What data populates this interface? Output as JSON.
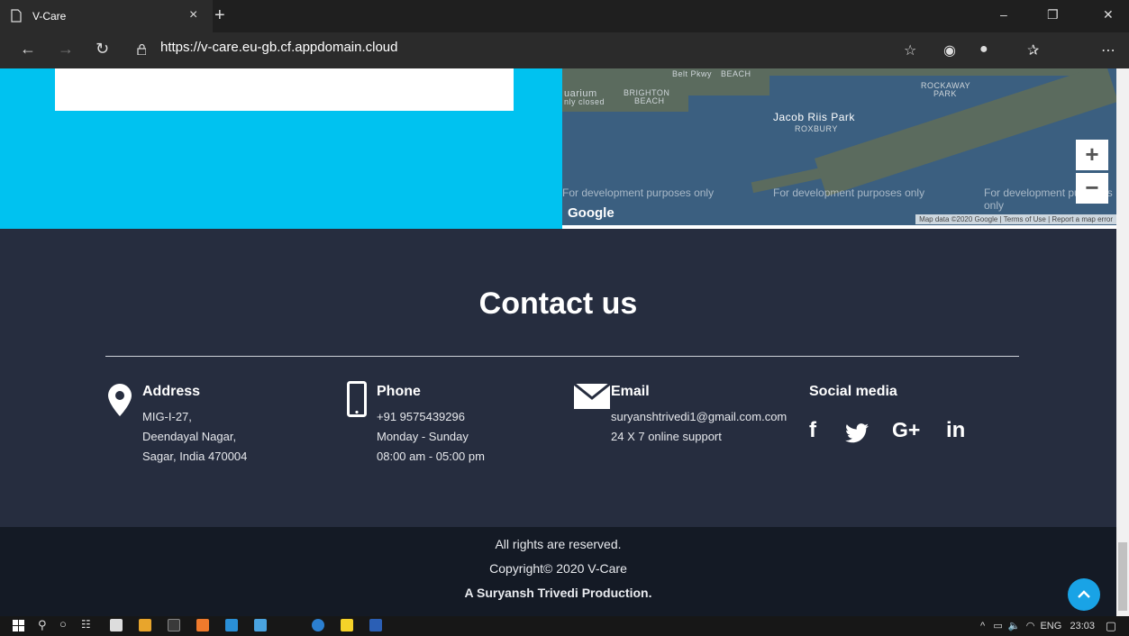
{
  "browser": {
    "tab_title": "V-Care",
    "url": "https://v-care.eu-gb.cf.appdomain.cloud",
    "window_controls": [
      "–",
      "❐",
      "✕"
    ]
  },
  "map": {
    "labels": [
      "Belt Pkwy",
      "BEACH",
      "uarium",
      "nly closed",
      "BRIGHTON",
      "BEACH",
      "ROCKAWAY",
      "PARK",
      "Jacob Riis Park",
      "ROXBURY"
    ],
    "dev_notice": "For development purposes only",
    "logo": "Google",
    "footer_links": [
      "Map data ©2020 Google",
      "Terms of Use",
      "Report a map error"
    ],
    "zoom_in": "+",
    "zoom_out": "−"
  },
  "contact": {
    "heading": "Contact us",
    "columns": [
      {
        "title": "Address",
        "icon": "location-pin-icon",
        "lines": [
          "MIG-I-27,",
          "Deendayal Nagar,",
          "Sagar, India 470004"
        ]
      },
      {
        "title": "Phone",
        "icon": "phone-icon",
        "lines": [
          "+91 9575439296",
          "Monday - Sunday",
          "08:00 am - 05:00 pm"
        ]
      },
      {
        "title": "Email",
        "icon": "envelope-icon",
        "lines": [
          "suryanshtrivedi1@gmail.com.com",
          "24 X 7 online support"
        ]
      },
      {
        "title": "Social media",
        "icon": "",
        "lines": []
      }
    ],
    "social": [
      "f",
      "G+",
      "in"
    ]
  },
  "footer": {
    "rights": "All rights are reserved.",
    "copyright": "Copyright© 2020 V-Care",
    "production": "A Suryansh Trivedi Production."
  },
  "taskbar": {
    "tray_lang": "ENG",
    "tray_time": "23:03"
  }
}
